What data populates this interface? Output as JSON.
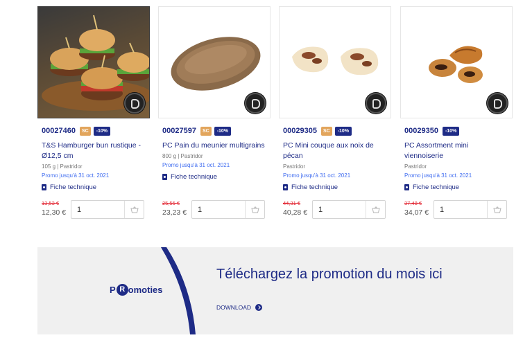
{
  "products": [
    {
      "code": "00027460",
      "sc_badge": "SC",
      "promo_badge": "-10%",
      "title_line1": "T&S Hamburger bun rustique -",
      "title_line2": "Ø12,5 cm",
      "sub": "105 g | Pastridor",
      "promo_text": "Promo jusqu'à 31 oct. 2021",
      "fiche": "Fiche technique",
      "old_price": "13,53 €",
      "new_price": "12,30 €",
      "qty": "1"
    },
    {
      "code": "00027597",
      "sc_badge": "SC",
      "promo_badge": "-10%",
      "title_line1": "PC Pain du meunier multigrains",
      "title_line2": "",
      "sub": "800 g | Pastridor",
      "promo_text": "Promo jusqu'à 31 oct. 2021",
      "fiche": "Fiche technique",
      "old_price": "25,55 €",
      "new_price": "23,23 €",
      "qty": "1"
    },
    {
      "code": "00029305",
      "sc_badge": "SC",
      "promo_badge": "-10%",
      "title_line1": "PC Mini couque aux noix de",
      "title_line2": "pécan",
      "sub": "Pastridor",
      "promo_text": "Promo jusqu'à 31 oct. 2021",
      "fiche": "Fiche technique",
      "old_price": "44,31 €",
      "new_price": "40,28 €",
      "qty": "1"
    },
    {
      "code": "00029350",
      "sc_badge": "",
      "promo_badge": "-10%",
      "title_line1": "PC Assortment mini",
      "title_line2": "viennoiserie",
      "sub": "Pastridor",
      "promo_text": "Promo jusqu'à 31 oct. 2021",
      "fiche": "Fiche technique",
      "old_price": "37,48 €",
      "new_price": "34,07 €",
      "qty": "1"
    }
  ],
  "banner": {
    "title": "Téléchargez la promotion du mois ici",
    "download_label": "DOWNLOAD",
    "logo_left": "P",
    "logo_r": "R",
    "logo_right": "omoties"
  },
  "colors": {
    "brand_blue": "#1e2b86",
    "sc_orange": "#e2a55c",
    "promo_link": "#3f6cf0",
    "old_price_red": "#e11d2a"
  },
  "icons": [
    "pdf-icon",
    "cart-icon",
    "arrow-circle-icon",
    "brand-seal-icon"
  ]
}
